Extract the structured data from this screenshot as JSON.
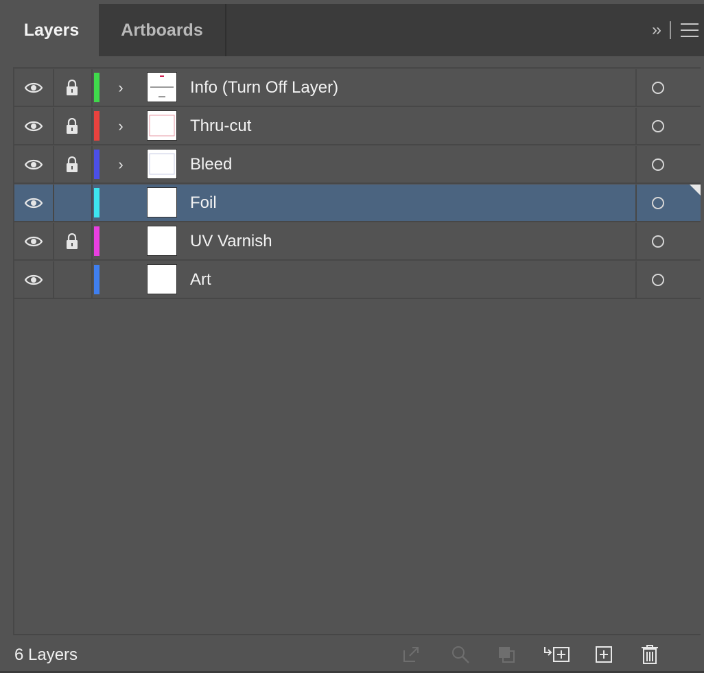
{
  "tabs": [
    {
      "label": "Layers",
      "active": true
    },
    {
      "label": "Artboards",
      "active": false
    }
  ],
  "tabbar": {
    "collapse_icon": "double-chevron-right-icon",
    "menu_icon": "hamburger-menu-icon"
  },
  "layers": [
    {
      "name": "Info (Turn Off Layer)",
      "visible": true,
      "locked": true,
      "expandable": true,
      "selected": false,
      "color": "#3fd94b",
      "thumbnail": "info-sheet"
    },
    {
      "name": "Thru-cut",
      "visible": true,
      "locked": true,
      "expandable": true,
      "selected": false,
      "color": "#e8423e",
      "thumbnail": "thru-cut-outline"
    },
    {
      "name": "Bleed",
      "visible": true,
      "locked": true,
      "expandable": true,
      "selected": false,
      "color": "#4b4fe6",
      "thumbnail": "bleed-outline"
    },
    {
      "name": "Foil",
      "visible": true,
      "locked": false,
      "expandable": false,
      "selected": true,
      "color": "#3de6f0",
      "thumbnail": "blank"
    },
    {
      "name": "UV Varnish",
      "visible": true,
      "locked": true,
      "expandable": false,
      "selected": false,
      "color": "#e83fe0",
      "thumbnail": "blank"
    },
    {
      "name": "Art",
      "visible": true,
      "locked": false,
      "expandable": false,
      "selected": false,
      "color": "#3f7ff0",
      "thumbnail": "blank"
    }
  ],
  "footer": {
    "count_label": "6 Layers",
    "actions": [
      {
        "name": "export-icon",
        "enabled": false
      },
      {
        "name": "locate-object-icon",
        "enabled": false
      },
      {
        "name": "clipping-mask-icon",
        "enabled": false
      },
      {
        "name": "new-sublayer-icon",
        "enabled": true
      },
      {
        "name": "new-layer-icon",
        "enabled": true
      },
      {
        "name": "trash-icon",
        "enabled": true
      }
    ]
  },
  "colors": {
    "panel_bg": "#535353",
    "tabbar_bg": "#3b3b3b",
    "selection_bg": "#4b6480"
  }
}
